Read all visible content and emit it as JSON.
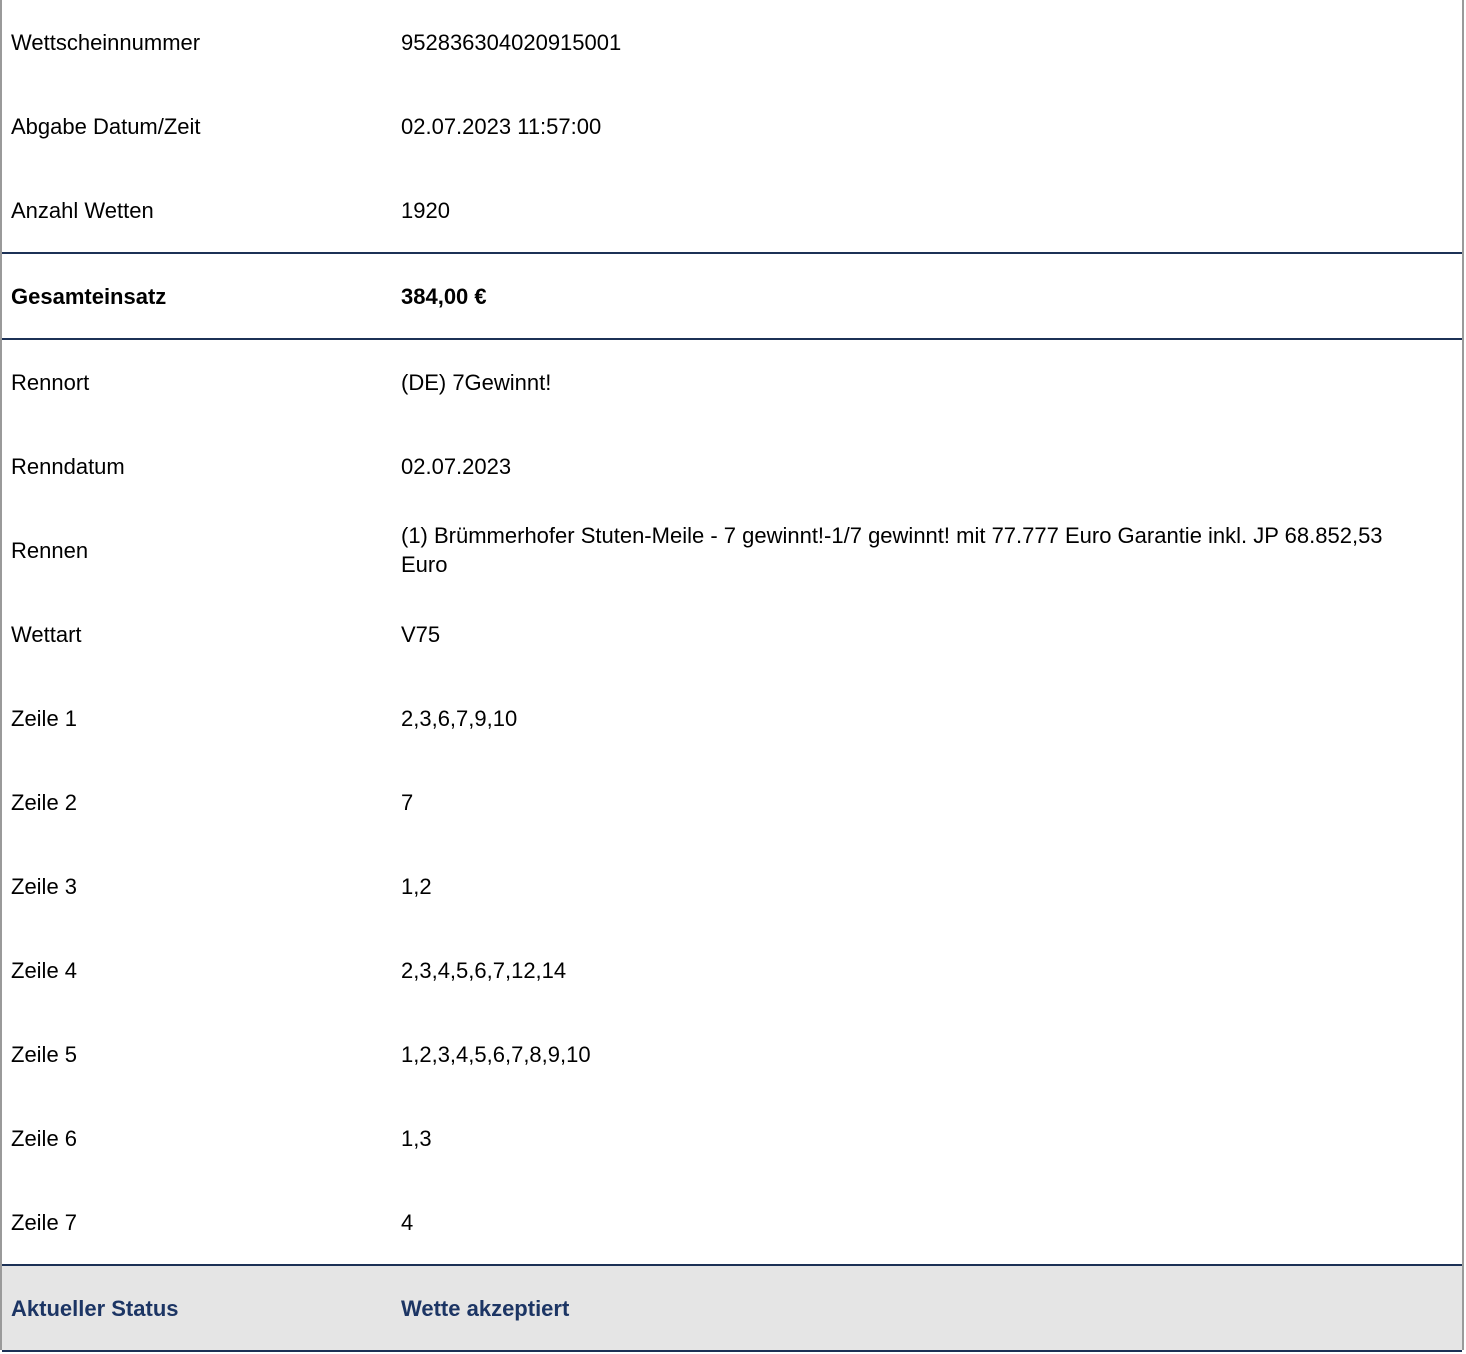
{
  "ticket": {
    "rows_top": [
      {
        "label": "Wettscheinnummer",
        "value": "952836304020915001"
      },
      {
        "label": "Abgabe Datum/Zeit",
        "value": "02.07.2023 11:57:00"
      },
      {
        "label": "Anzahl Wetten",
        "value": "1920"
      }
    ],
    "total": {
      "label": "Gesamteinsatz",
      "value": "384,00 €"
    },
    "rows_details": [
      {
        "label": "Rennort",
        "value": "(DE) 7Gewinnt!"
      },
      {
        "label": "Renndatum",
        "value": "02.07.2023"
      },
      {
        "label": "Rennen",
        "value": "(1) Brümmerhofer Stuten-Meile - 7 gewinnt!-1/7 gewinnt! mit 77.777 Euro Garantie inkl. JP 68.852,53 Euro"
      },
      {
        "label": "Wettart",
        "value": "V75"
      },
      {
        "label": "Zeile 1",
        "value": "2,3,6,7,9,10"
      },
      {
        "label": "Zeile 2",
        "value": "7"
      },
      {
        "label": "Zeile 3",
        "value": "1,2"
      },
      {
        "label": "Zeile 4",
        "value": "2,3,4,5,6,7,12,14"
      },
      {
        "label": "Zeile 5",
        "value": "1,2,3,4,5,6,7,8,9,10"
      },
      {
        "label": "Zeile 6",
        "value": "1,3"
      },
      {
        "label": "Zeile 7",
        "value": "4"
      }
    ],
    "status": {
      "label": "Aktueller Status",
      "value": "Wette akzeptiert"
    }
  },
  "colors": {
    "separator": "#1c3156",
    "status_text": "#1c3564",
    "status_background": "#e5e5e5",
    "side_border": "#9a9a9a"
  }
}
